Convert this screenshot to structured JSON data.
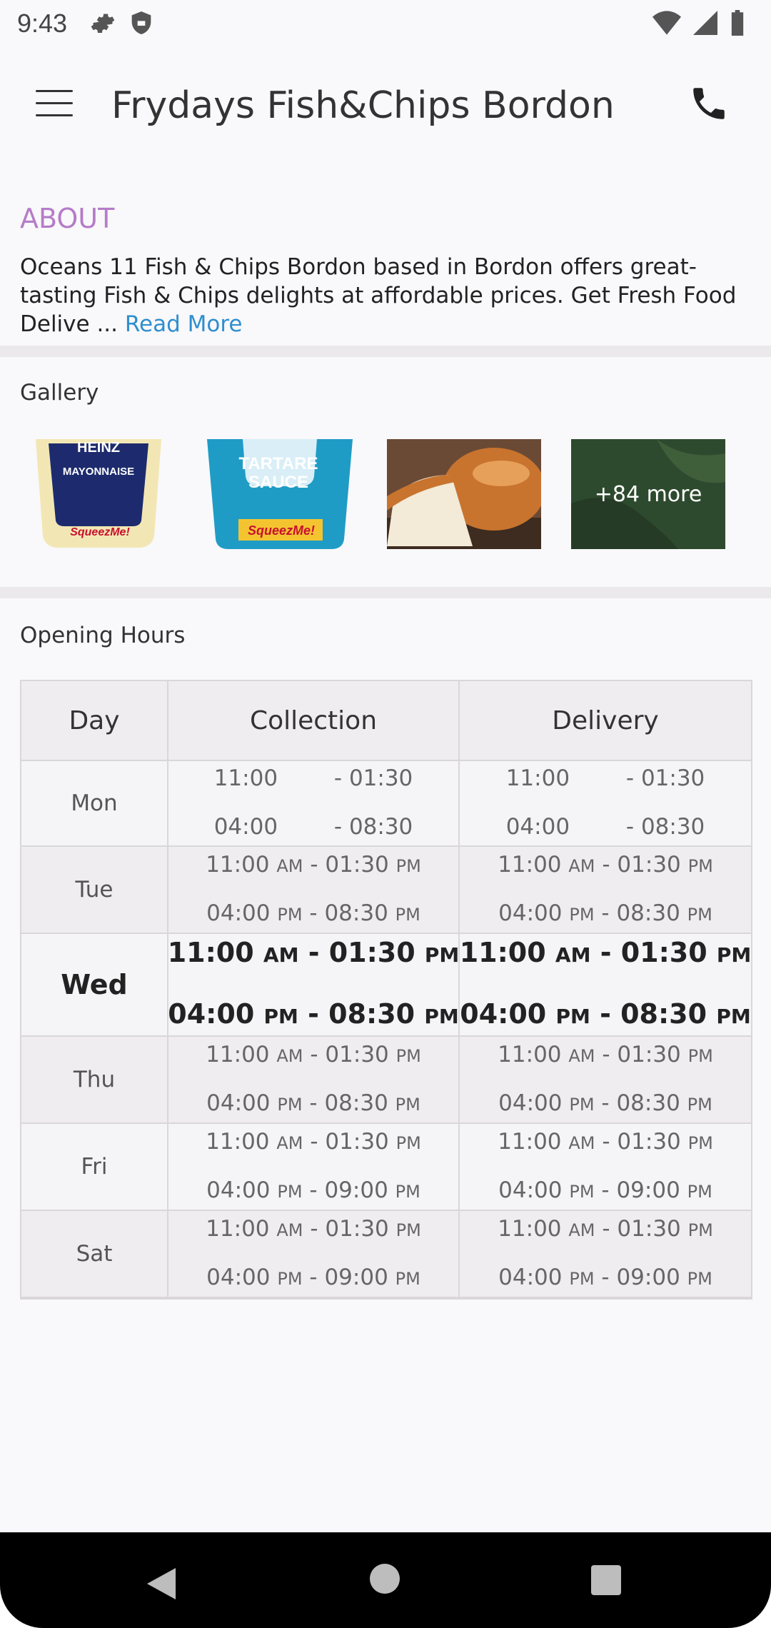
{
  "status_bar": {
    "time": "9:43"
  },
  "app_bar": {
    "title": "Frydays Fish&Chips Bordon"
  },
  "about": {
    "heading": "ABOUT",
    "text": "Oceans 11 Fish & Chips Bordon based in Bordon offers great-tasting Fish & Chips delights at affordable prices. Get Fresh Food Delive ...",
    "read_more": "Read More"
  },
  "gallery": {
    "label": "Gallery",
    "items": [
      {
        "name": "Mayonnaise",
        "brand": "HEINZ",
        "badge": "SqueezMe!"
      },
      {
        "name": "TARTARE SAUCE",
        "badge": "SqueezMe!"
      },
      {
        "name": "bread-roll"
      },
      {
        "more": "+84 more"
      }
    ]
  },
  "opening_hours": {
    "label": "Opening Hours",
    "headers": [
      "Day",
      "Collection",
      "Delivery"
    ],
    "rows": [
      {
        "day": "Mon",
        "collection": [
          [
            "11:00",
            "",
            "01:30",
            ""
          ],
          [
            "04:00",
            "",
            "08:30",
            ""
          ]
        ],
        "delivery": [
          [
            "11:00",
            "",
            "01:30",
            ""
          ],
          [
            "04:00",
            "",
            "08:30",
            ""
          ]
        ]
      },
      {
        "day": "Tue",
        "collection": [
          [
            "11:00",
            "AM",
            "01:30",
            "PM"
          ],
          [
            "04:00",
            "PM",
            "08:30",
            "PM"
          ]
        ],
        "delivery": [
          [
            "11:00",
            "AM",
            "01:30",
            "PM"
          ],
          [
            "04:00",
            "PM",
            "08:30",
            "PM"
          ]
        ]
      },
      {
        "day": "Wed",
        "collection": [
          [
            "11:00",
            "AM",
            "01:30",
            "PM"
          ],
          [
            "04:00",
            "PM",
            "08:30",
            "PM"
          ]
        ],
        "delivery": [
          [
            "11:00",
            "AM",
            "01:30",
            "PM"
          ],
          [
            "04:00",
            "PM",
            "08:30",
            "PM"
          ]
        ]
      },
      {
        "day": "Thu",
        "collection": [
          [
            "11:00",
            "AM",
            "01:30",
            "PM"
          ],
          [
            "04:00",
            "PM",
            "08:30",
            "PM"
          ]
        ],
        "delivery": [
          [
            "11:00",
            "AM",
            "01:30",
            "PM"
          ],
          [
            "04:00",
            "PM",
            "08:30",
            "PM"
          ]
        ]
      },
      {
        "day": "Fri",
        "collection": [
          [
            "11:00",
            "AM",
            "01:30",
            "PM"
          ],
          [
            "04:00",
            "PM",
            "09:00",
            "PM"
          ]
        ],
        "delivery": [
          [
            "11:00",
            "AM",
            "01:30",
            "PM"
          ],
          [
            "04:00",
            "PM",
            "09:00",
            "PM"
          ]
        ]
      },
      {
        "day": "Sat",
        "collection": [
          [
            "11:00",
            "AM",
            "01:30",
            "PM"
          ],
          [
            "04:00",
            "PM",
            "09:00",
            "PM"
          ]
        ],
        "delivery": [
          [
            "11:00",
            "AM",
            "01:30",
            "PM"
          ],
          [
            "04:00",
            "PM",
            "09:00",
            "PM"
          ]
        ]
      }
    ]
  },
  "colors": {
    "accent_heading": "#b57cc8",
    "link": "#2e8fcf"
  }
}
